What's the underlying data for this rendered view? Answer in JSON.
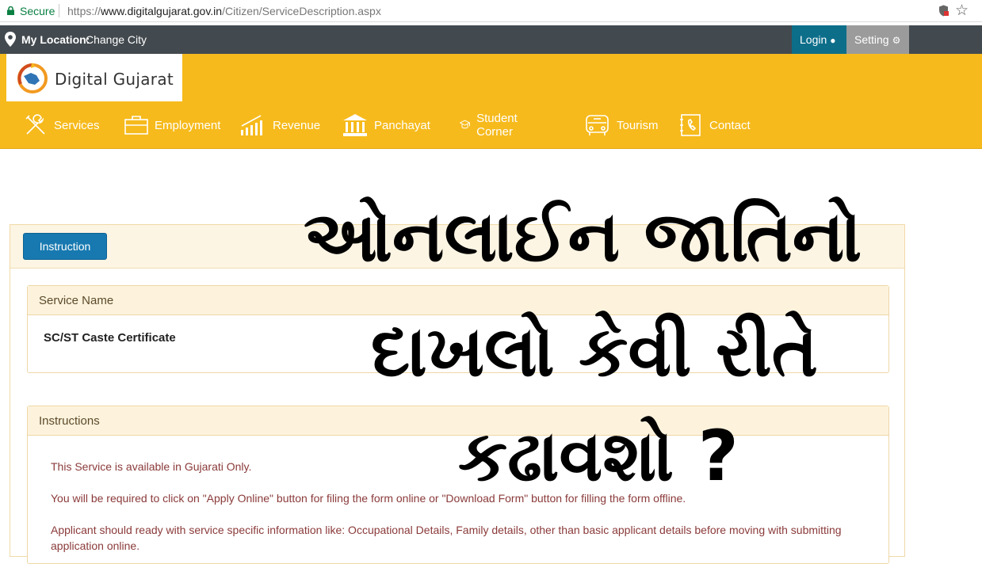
{
  "browser": {
    "secure_label": "Secure",
    "url_scheme": "https://",
    "url_host": "www.digitalgujarat.gov.in",
    "url_path": "/Citizen/ServiceDescription.aspx"
  },
  "topbar": {
    "location_label": "My Location:",
    "change_city": "Change City",
    "login": "Login",
    "setting": "Setting"
  },
  "header": {
    "logo_text": "Digital Gujarat",
    "nav": [
      {
        "label": "Services",
        "icon": "tools-icon"
      },
      {
        "label": "Employment",
        "icon": "briefcase-icon"
      },
      {
        "label": "Revenue",
        "icon": "bar-chart-icon"
      },
      {
        "label": "Panchayat",
        "icon": "building-icon"
      },
      {
        "label": "Student Corner",
        "icon": "graduation-icon"
      },
      {
        "label": "Tourism",
        "icon": "bus-icon"
      },
      {
        "label": "Contact",
        "icon": "phone-book-icon"
      }
    ]
  },
  "overlay": {
    "line1": "ઓનલાઈન  જાતિનો",
    "line2": "દાખલો કેવી રીતે",
    "line3": "કઢાવશો ?"
  },
  "main": {
    "instruction_button": "Instruction",
    "service_name_heading": "Service Name",
    "service_name_value": "SC/ST Caste Certificate",
    "instructions_heading": "Instructions",
    "instructions": [
      "This Service is available in Gujarati Only.",
      "You will be required to click on \"Apply Online\" button for filing the form online or \"Download Form\" button for filling the form offline.",
      "Applicant should ready with service specific information like: Occupational Details, Family details, other than basic applicant details before moving with submitting application online."
    ]
  },
  "colors": {
    "header_yellow": "#f6ba1c",
    "topbar_dark": "#434a4f",
    "login_blue": "#0d6e8a",
    "button_blue": "#1779b0",
    "instruction_text": "#8b3a3a"
  }
}
